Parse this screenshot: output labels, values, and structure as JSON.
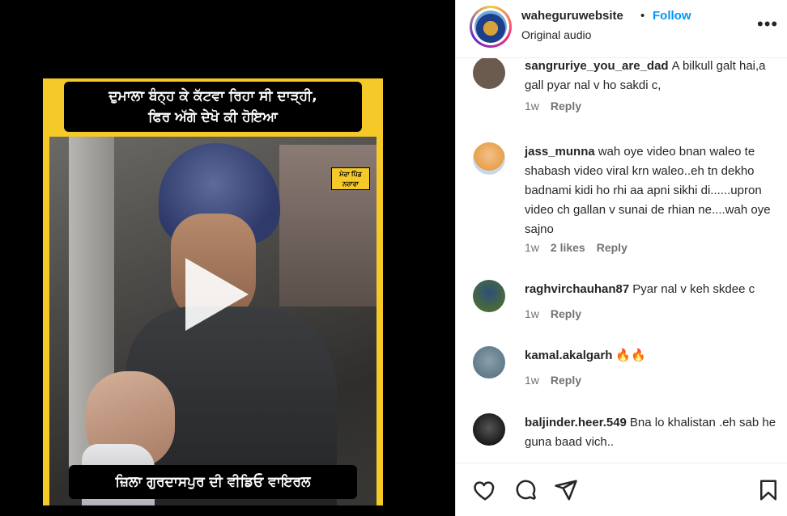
{
  "video": {
    "caption_top": "ਦੁਮਾਲਾ ਬੰਨ੍ਹ ਕੇ ਕੱਟਵਾ ਰਿਹਾ ਸੀ ਦਾੜ੍ਹੀ,\nਫਿਰ ਅੱਗੇ ਦੇਖੋ ਕੀ ਹੋਇਆ",
    "caption_bottom": "ਜ਼ਿਲਾ ਗੁਰਦਾਸਪੁਰ  ਦੀ ਵੀਡਿਓ ਵਾਇਰਲ",
    "stamp": "ਮੇਰਾ ਪਿੰਡ ਨਜ਼ਾਰਾ",
    "play_icon": "play-icon"
  },
  "header": {
    "username": "waheguruwebsite",
    "separator": "•",
    "follow": "Follow",
    "audio": "Original audio",
    "more": "•••"
  },
  "comments": [
    {
      "user": "sangruriye_you_are_dad",
      "text": "A bilkull galt hai,a gall pyar nal v ho sakdi c,",
      "time": "1w",
      "likes": "",
      "reply": "Reply",
      "avatar_color": "#6b5a4e"
    },
    {
      "user": "jass_munna",
      "text": "wah oye video bnan waleo te shabash video viral krn waleo..eh tn dekho badnami kidi ho rhi aa apni sikhi di......upron video ch gallan v sunai de rhian ne....wah oye sajno",
      "time": "1w",
      "likes": "2 likes",
      "reply": "Reply",
      "avatar_color": "#e8a04a"
    },
    {
      "user": "raghvirchauhan87",
      "text": "Pyar nal v keh skdee c",
      "time": "1w",
      "likes": "",
      "reply": "Reply",
      "avatar_color": "#4a6a3a"
    },
    {
      "user": "kamal.akalgarh",
      "text": "🔥🔥",
      "time": "1w",
      "likes": "",
      "reply": "Reply",
      "avatar_color": "#5f7a8a"
    },
    {
      "user": "baljinder.heer.549",
      "text": "Bna lo khalistan .eh sab he guna baad vich..",
      "time": "",
      "likes": "",
      "reply": "",
      "avatar_color": "#2a2a2a"
    }
  ],
  "footer": {
    "icons": [
      "heart-icon",
      "comment-icon",
      "share-icon",
      "bookmark-icon"
    ]
  }
}
